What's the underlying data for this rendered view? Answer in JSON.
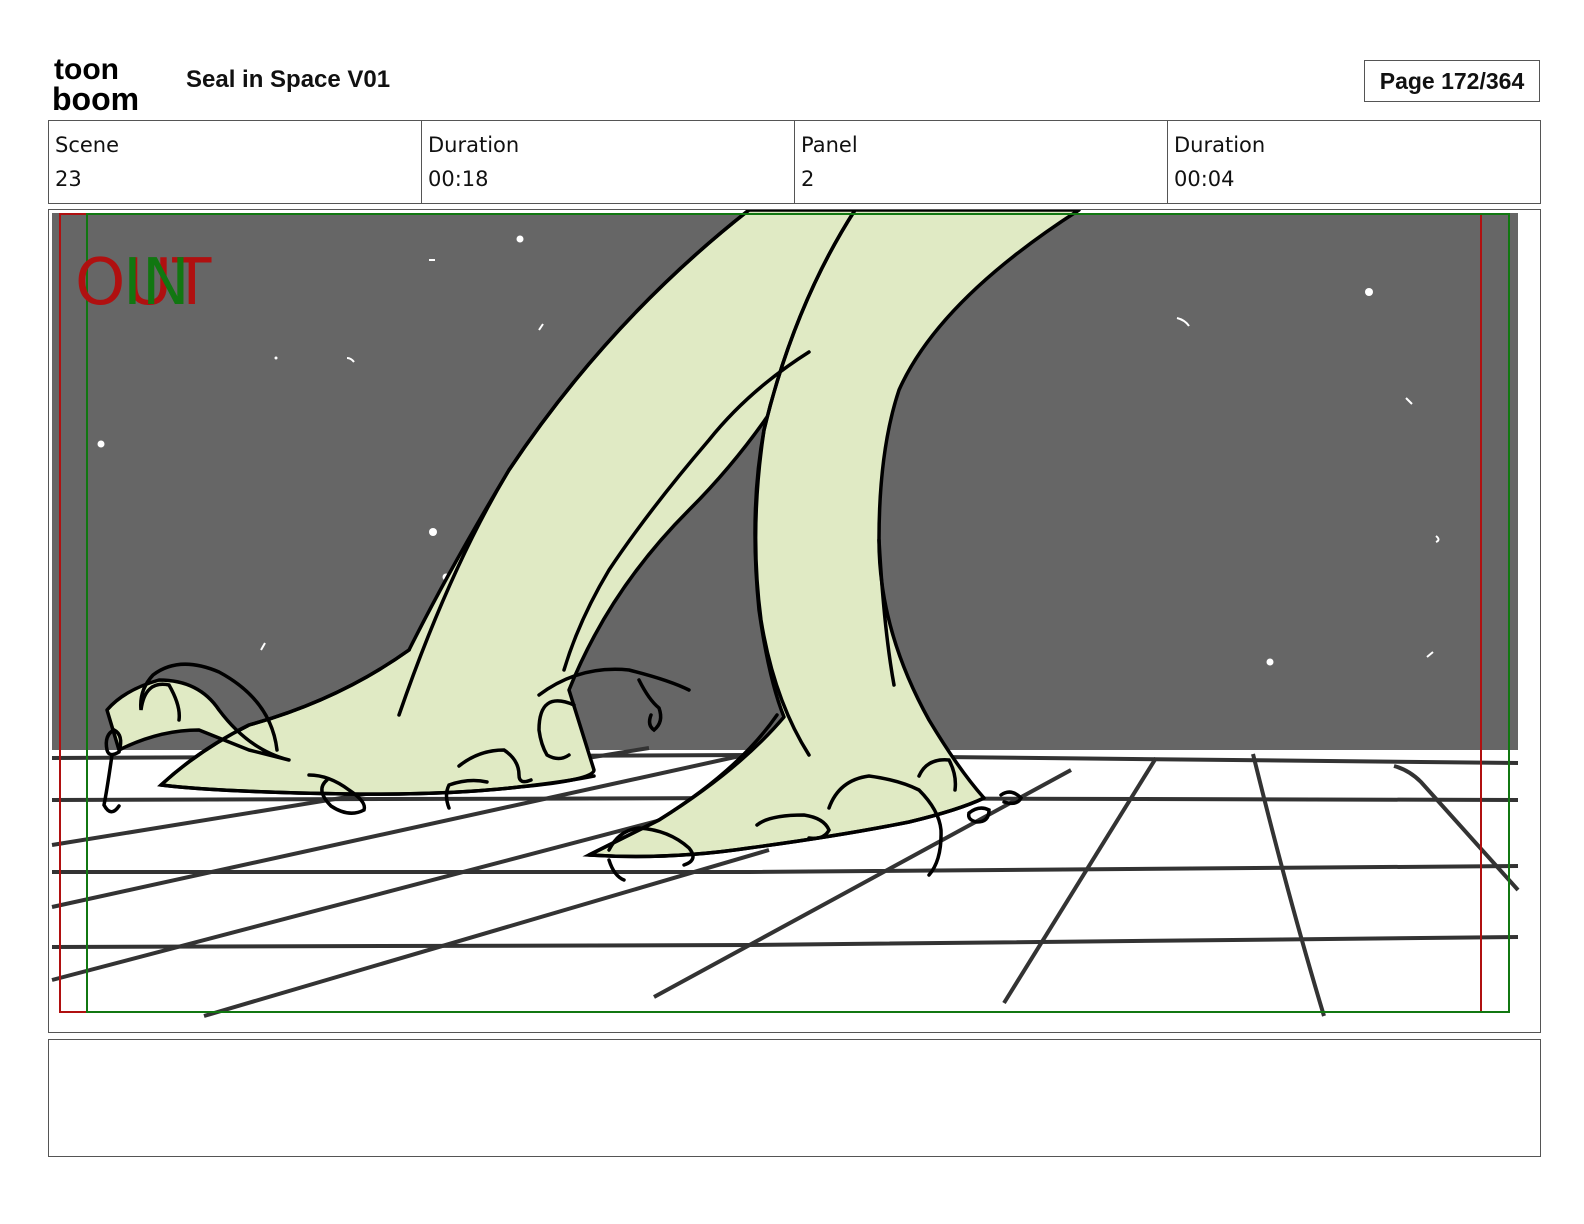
{
  "header": {
    "logo_lines": [
      "toon",
      "boom"
    ],
    "project_title": "Seal in Space V01",
    "page_label": "Page 172/364"
  },
  "info": [
    {
      "label": "Scene",
      "value": "23"
    },
    {
      "label": "Duration",
      "value": "00:18"
    },
    {
      "label": "Panel",
      "value": "2"
    },
    {
      "label": "Duration",
      "value": "00:04"
    }
  ],
  "panel": {
    "in_marker": "IN",
    "out_marker": "OUT",
    "colors": {
      "sky": "#666666",
      "skin": "#e0eac4",
      "safe_frame_red": "#b01010",
      "safe_frame_green": "#117711",
      "floor_lines": "#333333"
    }
  },
  "notes": {
    "text": ""
  }
}
